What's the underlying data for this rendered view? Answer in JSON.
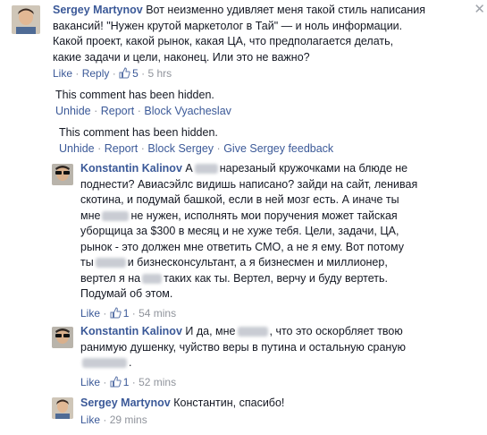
{
  "comments": [
    {
      "author": "Sergey Martynov",
      "lines": [
        "Вот неизменно удивляет меня такой стиль написания",
        "вакансий! \"Нужен крутой маркетолог в Тай\" — и ноль информации.",
        "Какой проект, какой рынок, какая ЦА, что предполагается делать,",
        "какие задачи и цели, наконец. Или это не важно?"
      ],
      "like_label": "Like",
      "reply_label": "Reply",
      "like_count": "5",
      "time": "5 hrs",
      "close_glyph": "✕"
    }
  ],
  "hidden_1": {
    "message": "This comment has been hidden.",
    "actions": [
      "Unhide",
      "Report",
      "Block Vyacheslav"
    ]
  },
  "hidden_2": {
    "message": "This comment has been hidden.",
    "actions": [
      "Unhide",
      "Report",
      "Block Sergey",
      "Give Sergey feedback"
    ]
  },
  "replies": [
    {
      "author": "Konstantin Kalinov",
      "l1_a": "А",
      "l1_b": "нарезаный кружочками на блюде не",
      "l2": "поднести? Авиасэйлс видишь написано? зайди на сайт, ленивая",
      "l3": "скотина, и подумай башкой, если в ней мозг есть. А иначе ты",
      "l4_a": "мне",
      "l4_b": "не нужен, исполнять мои поручения может тайская",
      "l5": "уборщица за $300 в месяц и не хуже тебя. Цели, задачи, ЦА,",
      "l6": "рынок - это должен мне ответить СМО, а не я ему. Вот потому",
      "l7_a": "ты",
      "l7_b": "и бизнесконсультант, а я бизнесмен и миллионер,",
      "l8_a": "вертел я на",
      "l8_b": "таких как ты. Вертел, верчу и буду вертеть.",
      "l9": "Подумай об этом.",
      "like_label": "Like",
      "like_count": "1",
      "time": "54 mins"
    },
    {
      "author": "Konstantin Kalinov",
      "l1_a": "И да, мне",
      "l1_b": ", что это оскорбляет твою",
      "l2": "ранимую душенку, чуйство веры в путина и остальную сраную",
      "l3_b": ".",
      "like_label": "Like",
      "like_count": "1",
      "time": "52 mins"
    },
    {
      "author": "Sergey Martynov",
      "text": "Константин, спасибо!",
      "like_label": "Like",
      "time": "29 mins"
    }
  ],
  "colors": {
    "link": "#3b5998",
    "meta": "#90949c",
    "text": "#141823"
  },
  "icons": [
    "thumbs-up-icon",
    "close-icon"
  ]
}
